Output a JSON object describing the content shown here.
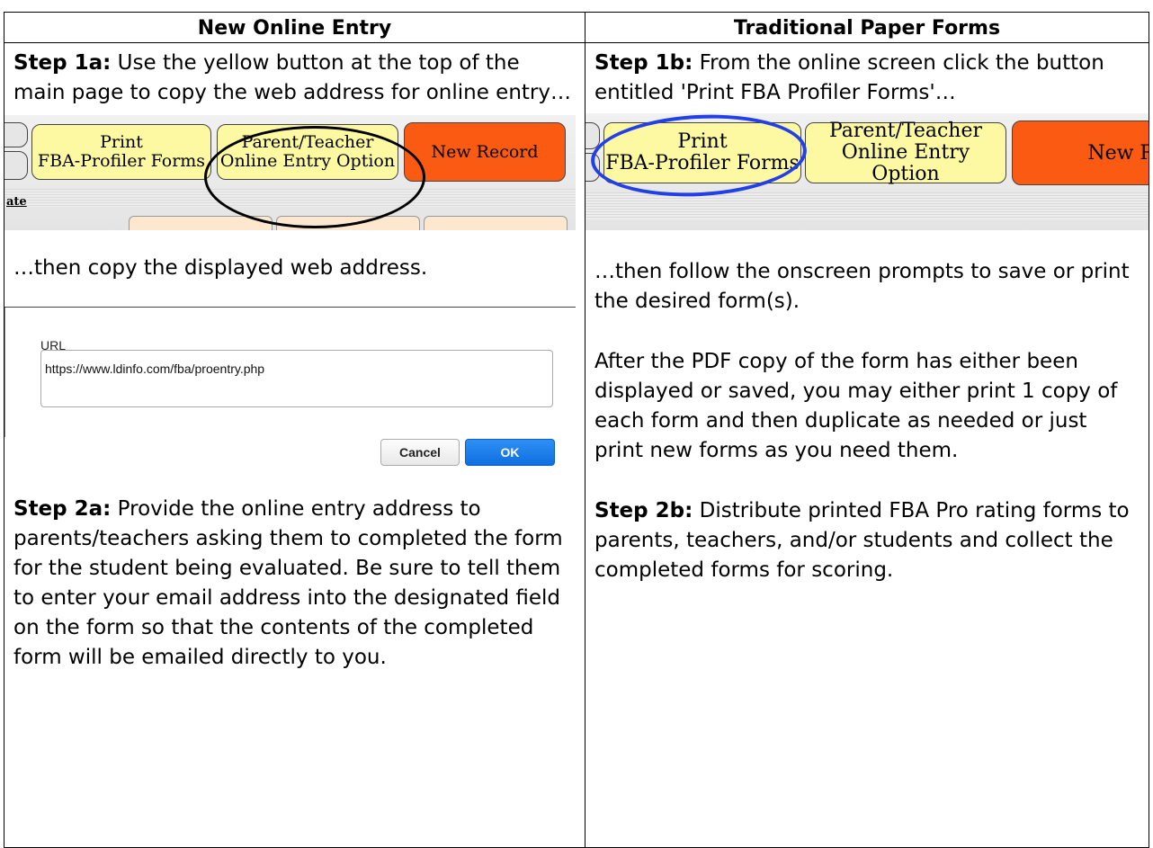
{
  "headers": {
    "left": "New Online Entry",
    "right": "Traditional Paper Forms"
  },
  "left": {
    "step1a_label": "Step 1a:",
    "step1a_text": " Use the yellow button at the top of the main page to copy the web address for online entry…",
    "toolbar": {
      "print_button": "Print FBA-Profiler Forms",
      "print_line1": "Print",
      "print_line2": "FBA-Profiler Forms",
      "parent_line1": "Parent/Teacher",
      "parent_line2": "Online Entry Option",
      "new_record": "New Record",
      "sub_label": "ate"
    },
    "then_copy": "…then copy the displayed web address.",
    "dialog": {
      "label": "URL",
      "url_value": "https://www.ldinfo.com/fba/proentry.php",
      "cancel": "Cancel",
      "ok": "OK"
    },
    "step2a_label": "Step 2a:",
    "step2a_text": "  Provide the online entry address to parents/teachers asking them to completed the form for the student being evaluated. Be sure to tell them to enter your email address into the designated field on the form so that the contents of the completed form will be emailed directly to you."
  },
  "right": {
    "step1b_label": "Step 1b:",
    "step1b_text": " From the online screen click the button entitled 'Print FBA Profiler Forms'…",
    "toolbar": {
      "print_line1": "Print",
      "print_line2": "FBA-Profiler Forms",
      "parent_line1": "Parent/Teacher",
      "parent_line2": "Online Entry Option",
      "new_record_partial": "New R"
    },
    "follow_text": "…then follow the onscreen prompts to save or print the desired form(s).",
    "after_text": "After the PDF copy of the form has either been displayed or saved, you may either print 1 copy of each form and then duplicate as needed or just print new forms as you need them.",
    "step2b_label": "Step 2b:",
    "step2b_text": " Distribute printed FBA Pro rating forms to parents, teachers, and/or students and collect the completed forms for scoring."
  },
  "colors": {
    "yellow_button": "#fdf9a2",
    "orange_button": "#fb5a12",
    "ok_blue": "#0f6fe0",
    "highlight_oval_blue": "#2140e8"
  }
}
